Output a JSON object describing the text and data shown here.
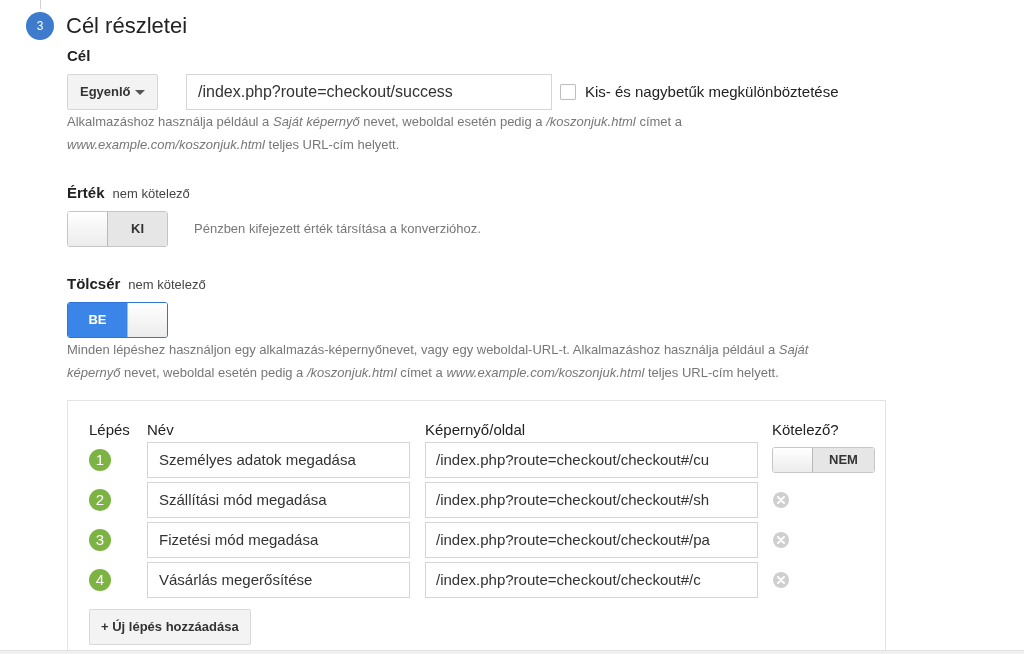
{
  "section": {
    "number": "3",
    "title": "Cél részletei"
  },
  "goal": {
    "label": "Cél",
    "match_type": "Egyenlő",
    "destination": "/index.php?route=checkout/success",
    "case_sensitive": {
      "label": "Kis- és nagybetűk megkülönböztetése",
      "checked": false
    },
    "help": "Alkalmazáshoz használja például a *Saját képernyő* nevet, weboldal esetén pedig a */koszonjuk.html* címet a *www.example.com/koszonjuk.html* teljes URL-cím helyett."
  },
  "value": {
    "label": "Érték",
    "note": "nem kötelező",
    "toggle": {
      "on": false,
      "label": "KI"
    },
    "description": "Pénzben kifejezett érték társítása a konverzióhoz."
  },
  "funnel": {
    "label": "Tölcsér",
    "note": "nem kötelező",
    "toggle": {
      "on": true,
      "label": "BE"
    },
    "help": "Minden lépéshez használjon egy alkalmazás-képernyőnevet, vagy egy weboldal-URL-t. Alkalmazáshoz használja például a *Saját képernyő* nevet, weboldal esetén pedig a */koszonjuk.html* címet a *www.example.com/koszonjuk.html* teljes URL-cím helyett.",
    "columns": [
      "Lépés",
      "Név",
      "Képernyő/oldal",
      "Kötelező?"
    ],
    "steps": [
      {
        "number": "1",
        "name": "Személyes adatok megadása",
        "page": "/index.php?route=checkout/checkout#/cu",
        "kind": "toggle",
        "required": {
          "on": false,
          "label": "NEM"
        }
      },
      {
        "number": "2",
        "name": "Szállítási mód megadása",
        "page": "/index.php?route=checkout/checkout#/sh",
        "kind": "remove"
      },
      {
        "number": "3",
        "name": "Fizetési mód megadása",
        "page": "/index.php?route=checkout/checkout#/pa",
        "kind": "remove"
      },
      {
        "number": "4",
        "name": "Vásárlás megerősítése",
        "page": "/index.php?route=checkout/checkout#/c",
        "kind": "remove"
      }
    ],
    "add_button": "+ Új lépés hozzáadása"
  }
}
